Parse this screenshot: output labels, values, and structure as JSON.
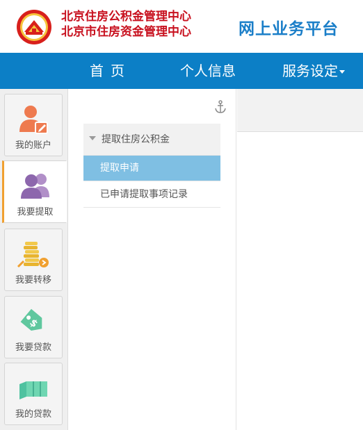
{
  "header": {
    "org_line_1": "北京住房公积金管理中心",
    "org_line_2": "北京市住房资金管理中心",
    "platform_title": "网上业务平台",
    "logo_icon": "housing-fund-emblem-icon"
  },
  "nav": {
    "home": "首页",
    "profile": "个人信息",
    "service": "服务设定"
  },
  "rail": {
    "items": [
      {
        "label": "我的账户",
        "icon": "account-user-edit-icon"
      },
      {
        "label": "我要提取",
        "icon": "users-group-icon"
      },
      {
        "label": "我要转移",
        "icon": "coin-stack-transfer-icon"
      },
      {
        "label": "我要贷款",
        "icon": "price-tag-dollar-icon"
      },
      {
        "label": "我的贷款",
        "icon": "loan-cash-icon"
      }
    ],
    "active_index": 1
  },
  "submenu": {
    "group_label": "提取住房公积金",
    "items": [
      {
        "label": "提取申请",
        "active": true
      },
      {
        "label": "已申请提取事项记录",
        "active": false
      }
    ]
  },
  "colors": {
    "nav_blue": "#0c7fc6",
    "brand_red": "#c8101e",
    "title_blue": "#1a7ec8",
    "active_item": "#7fbfe3",
    "rail_active_accent": "#f0a030"
  }
}
